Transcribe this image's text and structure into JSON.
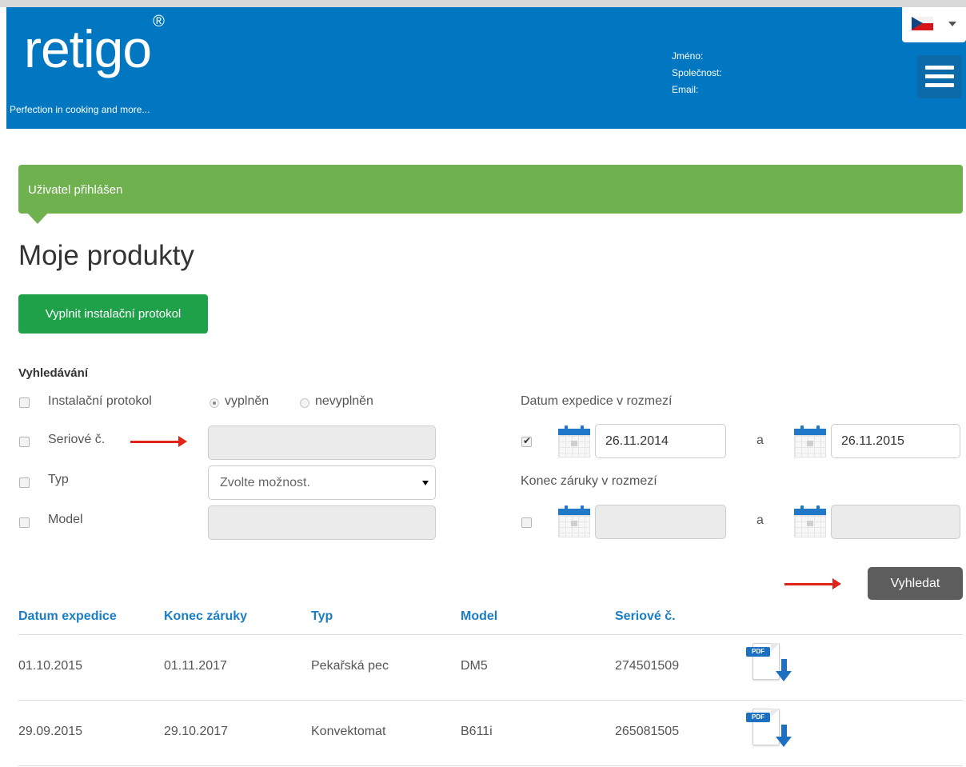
{
  "header": {
    "logo_text": "retigo",
    "logo_mark": "®",
    "tagline": "Perfection in cooking and more...",
    "user_labels": [
      "Jméno:",
      "Společnost:",
      "Email:"
    ],
    "language_icon": "czech-flag-icon",
    "menu_icon": "hamburger-menu-icon",
    "brand_color": "#0077c0"
  },
  "alert": {
    "text": "Uživatel přihlášen",
    "color": "#6fb04f"
  },
  "page": {
    "title": "Moje produkty",
    "primary_button": "Vyplnit instalační protokol"
  },
  "search": {
    "heading": "Vyhledávání",
    "install_protocol_label": "Instalační protokol",
    "radio_filled": "vyplněn",
    "radio_unfilled": "nevyplněn",
    "serial_label": "Seriové č.",
    "serial_value": "",
    "type_label": "Typ",
    "type_placeholder": "Zvolte možnost.",
    "model_label": "Model",
    "model_value": "",
    "expedition_range_label": "Datum expedice v rozmezí",
    "expedition_from": "26.11.2014",
    "expedition_to": "26.11.2015",
    "range_separator": "a",
    "warranty_range_label": "Konec záruky v rozmezí",
    "warranty_from": "",
    "warranty_to": "",
    "search_button": "Vyhledat"
  },
  "table": {
    "columns": [
      "Datum expedice",
      "Konec záruky",
      "Typ",
      "Model",
      "Seriové č."
    ],
    "rows": [
      {
        "expedition": "01.10.2015",
        "warranty_end": "01.11.2017",
        "type": "Pekařská pec",
        "model": "DM5",
        "serial": "274501509",
        "icon": "pdf-download-icon",
        "icon_label": "PDF"
      },
      {
        "expedition": "29.09.2015",
        "warranty_end": "29.10.2017",
        "type": "Konvektomat",
        "model": "B611i",
        "serial": "265081505",
        "icon": "pdf-download-icon",
        "icon_label": "PDF"
      }
    ]
  }
}
